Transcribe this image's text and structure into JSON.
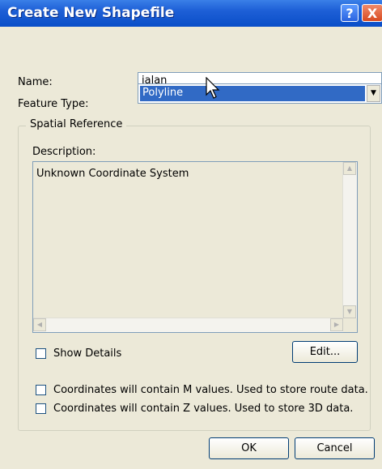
{
  "window": {
    "title": "Create New Shapefile",
    "help_glyph": "?",
    "close_glyph": "X"
  },
  "form": {
    "name_label": "Name:",
    "name_value": "jalan",
    "feature_type_label": "Feature Type:",
    "feature_type_value": "Polyline"
  },
  "spatial_reference": {
    "group_label": "Spatial Reference",
    "description_label": "Description:",
    "description_text": "Unknown Coordinate System",
    "show_details_label": "Show Details",
    "show_details_checked": false,
    "edit_button": "Edit..."
  },
  "options": {
    "m_values_label": "Coordinates will contain M values. Used to store route data.",
    "m_values_checked": false,
    "z_values_label": "Coordinates will contain Z values. Used to store 3D data.",
    "z_values_checked": false
  },
  "buttons": {
    "ok": "OK",
    "cancel": "Cancel"
  },
  "icons": {
    "dropdown": "chevron-down-icon",
    "scroll_up": "scroll-up-arrow-icon",
    "scroll_down": "scroll-down-arrow-icon",
    "scroll_left": "scroll-left-arrow-icon",
    "scroll_right": "scroll-right-arrow-icon",
    "cursor": "mouse-pointer-icon"
  },
  "colors": {
    "title_bar": "#1d5fd6",
    "selection": "#316ac5",
    "dialog_bg": "#ECE9D8"
  }
}
